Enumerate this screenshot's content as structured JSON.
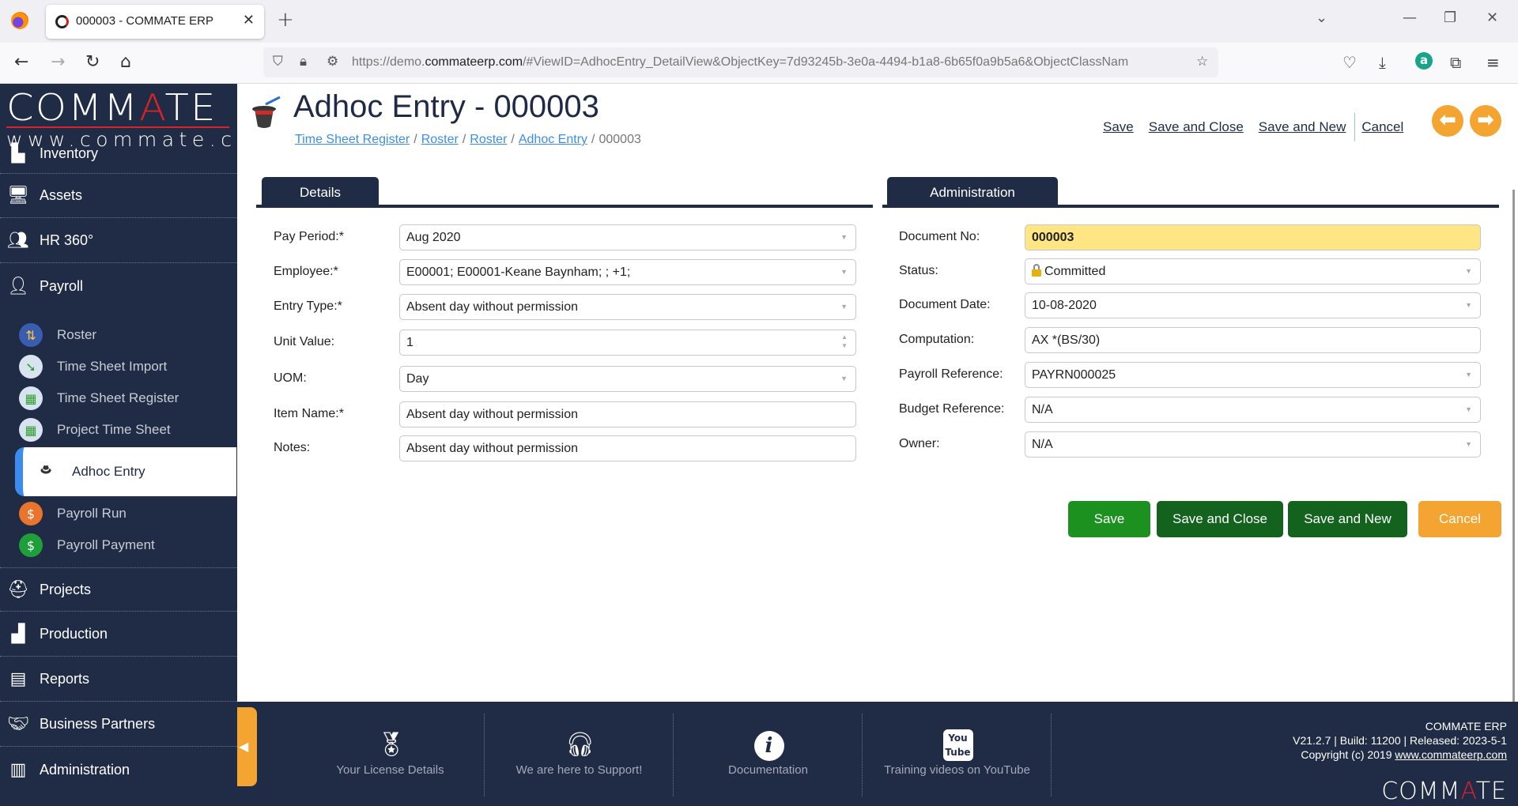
{
  "browser": {
    "tab_title": "000003 - COMMATE ERP",
    "url_prefix": "https://demo.",
    "url_domain": "commateerp.com",
    "url_rest": "/#ViewID=AdhocEntry_DetailView&ObjectKey=7d93245b-3e0a-4494-b1a8-6b65f0a9b5a6&ObjectClassNam"
  },
  "logo": {
    "main_a": "COMM",
    "main_red": "A",
    "main_b": "TE",
    "sub": "www.commate.ca"
  },
  "sidebar": {
    "items": [
      {
        "label": "Inventory",
        "icon": "forklift-icon"
      },
      {
        "label": "Assets",
        "icon": "computer-icon"
      },
      {
        "label": "HR 360°",
        "icon": "people-icon"
      },
      {
        "label": "Payroll",
        "icon": "payroll-icon"
      },
      {
        "label": "Projects",
        "icon": "hardhat-icon"
      },
      {
        "label": "Production",
        "icon": "factory-icon"
      },
      {
        "label": "Reports",
        "icon": "report-icon"
      },
      {
        "label": "Business Partners",
        "icon": "handshake-icon"
      },
      {
        "label": "Administration",
        "icon": "admin-icon"
      }
    ],
    "payroll_sub": [
      {
        "label": "Roster",
        "icon": "roster-icon"
      },
      {
        "label": "Time Sheet Import",
        "icon": "timesheet-import-icon"
      },
      {
        "label": "Time Sheet Register",
        "icon": "timesheet-register-icon"
      },
      {
        "label": "Project Time Sheet",
        "icon": "project-timesheet-icon"
      },
      {
        "label": "Adhoc Entry",
        "icon": "magic-hat-icon",
        "active": true
      },
      {
        "label": "Payroll Run",
        "icon": "payroll-run-icon"
      },
      {
        "label": "Payroll Payment",
        "icon": "payroll-payment-icon"
      }
    ]
  },
  "header": {
    "title": "Adhoc Entry - 000003",
    "breadcrumb": [
      "Time Sheet Register",
      "Roster",
      "Roster",
      "Adhoc Entry"
    ],
    "breadcrumb_current": "000003",
    "actions": {
      "save": "Save",
      "save_close": "Save and Close",
      "save_new": "Save and New",
      "cancel": "Cancel"
    }
  },
  "details": {
    "tab": "Details",
    "fields": [
      {
        "label": "Pay Period:*",
        "value": "Aug 2020",
        "type": "dropdown"
      },
      {
        "label": "Employee:*",
        "value": "E00001; E00001-Keane Baynham; ; +1;",
        "type": "dropdown"
      },
      {
        "label": "Entry Type:*",
        "value": "Absent day without permission",
        "type": "dropdown"
      },
      {
        "label": "Unit Value:",
        "value": "1",
        "type": "spinner"
      },
      {
        "label": "UOM:",
        "value": "Day",
        "type": "dropdown"
      },
      {
        "label": "Item Name:*",
        "value": "Absent day without permission",
        "type": "text"
      },
      {
        "label": "Notes:",
        "value": "Absent day without permission",
        "type": "text"
      }
    ]
  },
  "administration": {
    "tab": "Administration",
    "fields": [
      {
        "label": "Document No:",
        "value": "000003",
        "type": "readonly"
      },
      {
        "label": "Status:",
        "value": "Committed",
        "type": "dropdown"
      },
      {
        "label": "Document Date:",
        "value": "10-08-2020",
        "type": "dropdown"
      },
      {
        "label": "Computation:",
        "value": "AX *(BS/30)",
        "type": "text"
      },
      {
        "label": "Payroll Reference:",
        "value": "PAYRN000025",
        "type": "dropdown"
      },
      {
        "label": "Budget Reference:",
        "value": "N/A",
        "type": "dropdown"
      },
      {
        "label": "Owner:",
        "value": "N/A",
        "type": "dropdown"
      }
    ]
  },
  "buttons": {
    "save": "Save",
    "save_close": "Save and Close",
    "save_new": "Save and New",
    "cancel": "Cancel"
  },
  "colors": {
    "navy": "#202b46",
    "save_green": "#1d9120",
    "dark_green": "#13631f",
    "orange": "#f4a431",
    "highlight_yellow": "#ffe583",
    "link_blue": "#3b8ee8"
  },
  "footer": {
    "items": [
      {
        "label": "Your License Details",
        "icon": "award-ribbon-icon"
      },
      {
        "label": "We are here to Support!",
        "icon": "support-headset-icon"
      },
      {
        "label": "Documentation",
        "icon": "info-icon"
      },
      {
        "label": "Training videos on YouTube",
        "icon": "youtube-icon"
      }
    ],
    "product": "COMMATE ERP",
    "version": "V21.2.7 | Build: 11200 | Released: 2023-5-1",
    "copyright": "Copyright (c) 2019 ",
    "site_link": "www.commateerp.com",
    "logo_a": "COMM",
    "logo_red": "A",
    "logo_b": "TE"
  }
}
